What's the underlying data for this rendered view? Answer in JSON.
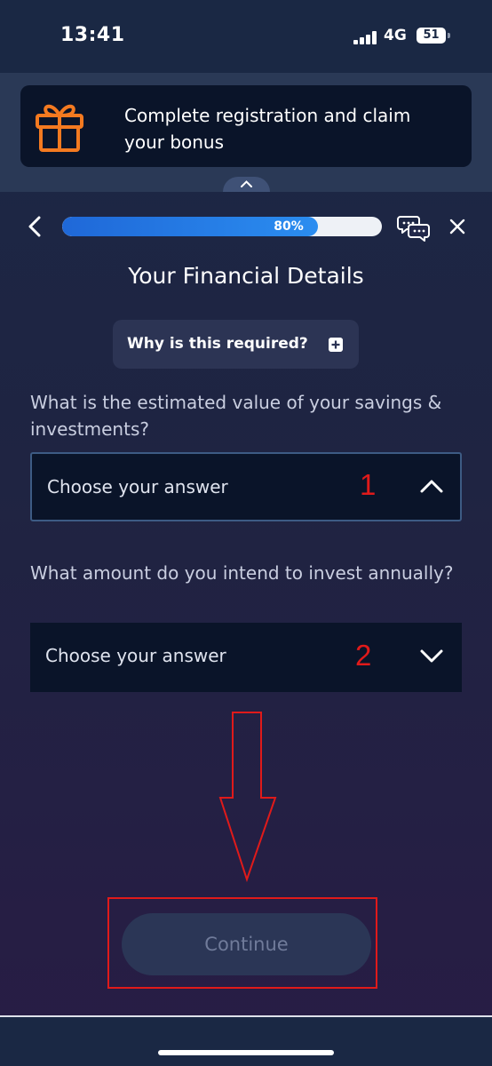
{
  "status_bar": {
    "time": "13:41",
    "network": "4G",
    "battery": "51",
    "icons": [
      "signal-icon",
      "battery-icon"
    ]
  },
  "banner": {
    "text": "Complete registration and claim your bonus",
    "icon": "gift-icon",
    "accent_color": "#f47a20"
  },
  "header": {
    "progress_percent": 80,
    "progress_label": "80%",
    "icons": [
      "back-icon",
      "chat-icon",
      "close-icon"
    ]
  },
  "page": {
    "title": "Your Financial Details",
    "why_button_label": "Why is this required?"
  },
  "questions": [
    {
      "label": "What is the estimated value of your savings & investments?",
      "placeholder": "Choose your answer",
      "state": "expanded"
    },
    {
      "label": "What amount do you intend to invest annually?",
      "placeholder": "Choose your answer",
      "state": "collapsed"
    }
  ],
  "annotations": {
    "marker_1": "1",
    "marker_2": "2",
    "color": "#e01a1a"
  },
  "footer": {
    "continue_label": "Continue"
  }
}
